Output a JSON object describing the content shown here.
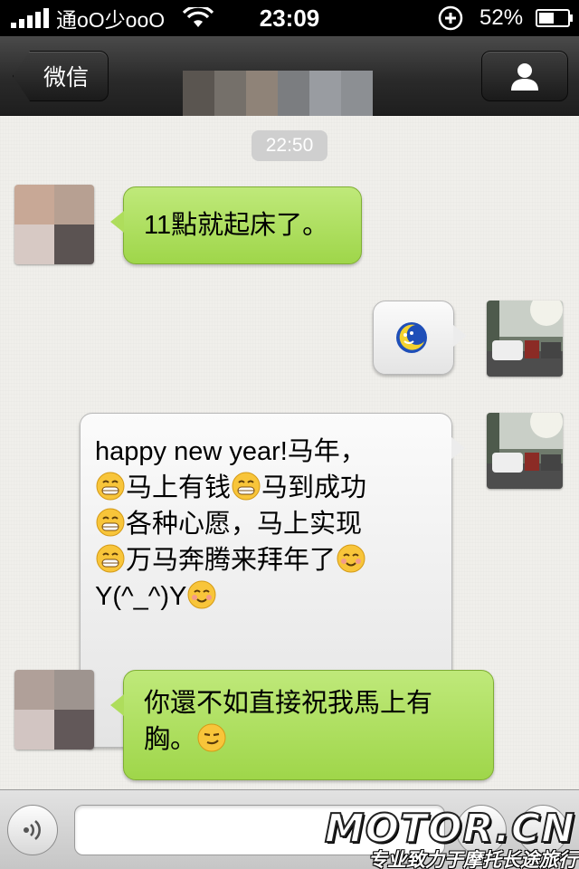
{
  "status_bar": {
    "carrier": "通oO少ooO",
    "time": "23:09",
    "battery": "52%"
  },
  "nav": {
    "back_label": "微信",
    "title_obscured": true,
    "icons": {
      "back": "chevron-left-icon",
      "profile": "person-icon"
    }
  },
  "chat": {
    "timestamp": "22:50",
    "messages": [
      {
        "side": "left",
        "sender": "contact",
        "text": "11點就起床了。",
        "bubble_color": "#a8db55"
      },
      {
        "side": "right",
        "sender": "me",
        "type": "sticker",
        "icon": "moon-face-icon"
      },
      {
        "side": "right",
        "sender": "me",
        "lines": [
          {
            "prefix": "",
            "text": "happy new year!马年，"
          },
          {
            "prefix": "grin-emoji",
            "text": "马上有钱"
          },
          {
            "prefix": "grin-emoji",
            "text": "马到成功"
          },
          {
            "prefix": "grin-emoji",
            "text": "各种心愿，马上实现"
          },
          {
            "prefix": "grin-emoji",
            "text": "万马奔腾来拜年了"
          },
          {
            "prefix": "",
            "text": "Y(^_^)Y"
          }
        ],
        "bubble_color": "#efefef"
      },
      {
        "side": "left",
        "sender": "contact",
        "line1": "你還不如直接祝我馬上有",
        "line2": "胸。",
        "suffix_emoji": "smirk-emoji",
        "bubble_color": "#a8db55"
      }
    ]
  },
  "input_bar": {
    "input_value": "",
    "icons": {
      "voice": "voice-icon",
      "emoji": "emoji-icon",
      "plus": "plus-icon"
    }
  },
  "watermark": {
    "logo": "MOTOR.CN",
    "slogan": "专业致力于摩托长途旅行"
  }
}
